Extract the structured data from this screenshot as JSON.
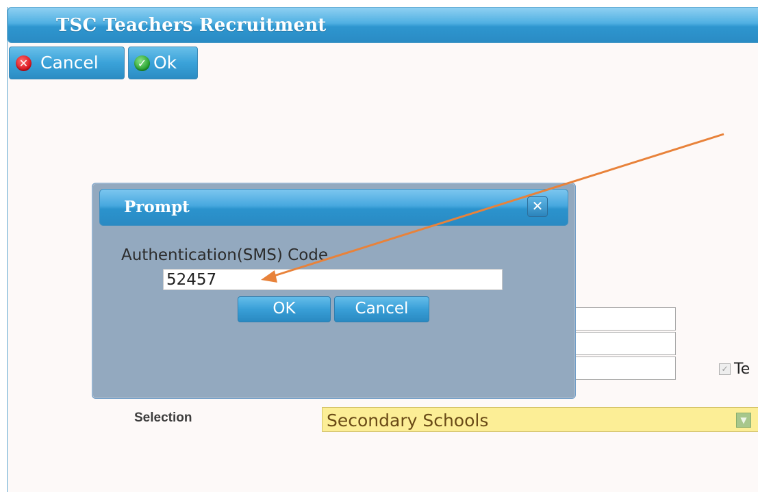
{
  "window": {
    "title": "TSC Teachers Recruitment"
  },
  "toolbar": {
    "cancel_label": "Cancel",
    "ok_label": "Ok"
  },
  "form": {
    "checkbox_label_partial": "Te",
    "checkbox_checked": true,
    "selection_label": "Selection",
    "selection_value": "Secondary Schools"
  },
  "dialog": {
    "title": "Prompt",
    "field_label": "Authentication(SMS) Code",
    "field_value": "52457",
    "ok_label": "OK",
    "cancel_label": "Cancel"
  },
  "icons": {
    "cancel": "x-circle-icon",
    "ok": "check-circle-icon",
    "close": "close-icon",
    "dropdown": "chevron-down-icon"
  },
  "colors": {
    "accent_blue": "#2e96cf",
    "dialog_body": "#93a9bf",
    "select_bg": "#fcee96",
    "annotation_arrow": "#e8823a"
  }
}
